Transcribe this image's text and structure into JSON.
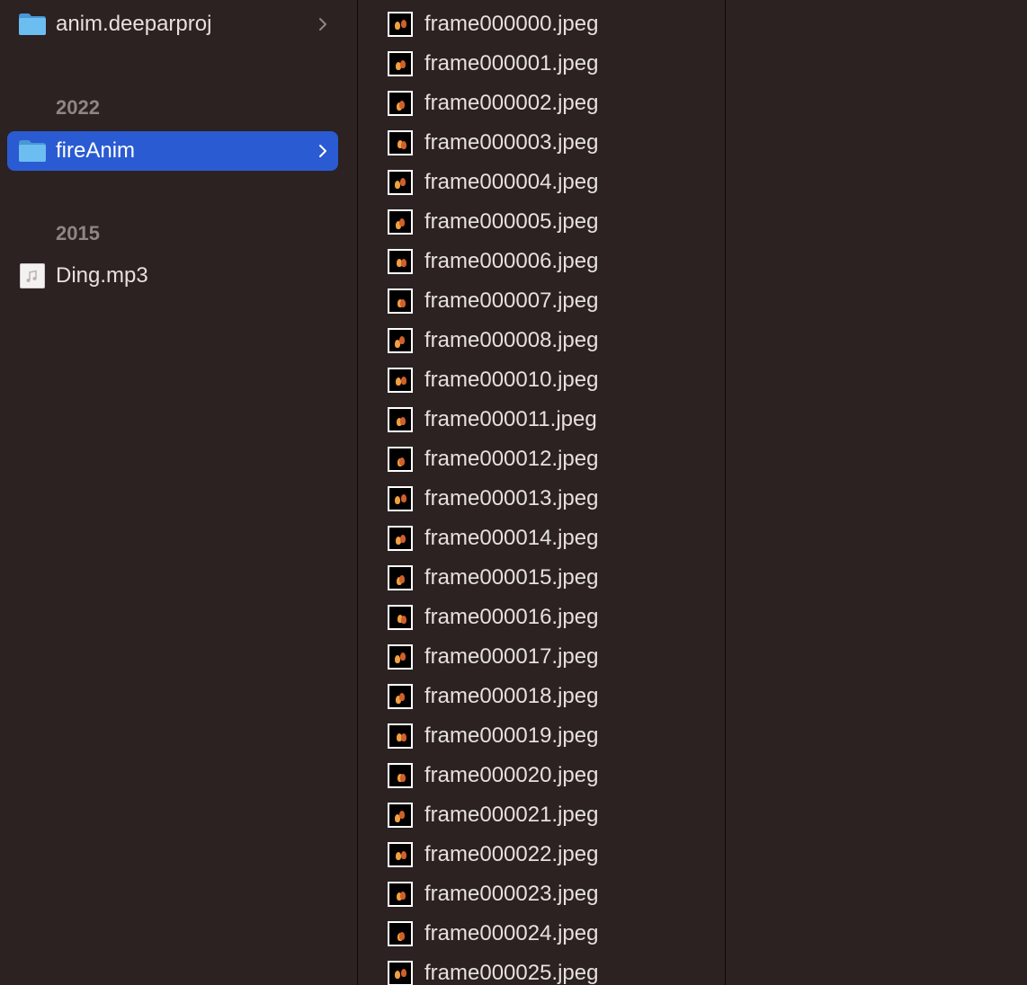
{
  "finder": {
    "column1": {
      "top_item": {
        "label": "anim.deeparproj",
        "icon": "folder-icon"
      },
      "sections": [
        {
          "header": "2022",
          "item": {
            "label": "fireAnim",
            "icon": "folder-icon",
            "selected": true
          }
        },
        {
          "header": "2015",
          "item": {
            "label": "Ding.mp3",
            "icon": "music-file-icon",
            "selected": false
          }
        }
      ]
    },
    "column2": {
      "files": [
        "frame000000.jpeg",
        "frame000001.jpeg",
        "frame000002.jpeg",
        "frame000003.jpeg",
        "frame000004.jpeg",
        "frame000005.jpeg",
        "frame000006.jpeg",
        "frame000007.jpeg",
        "frame000008.jpeg",
        "frame000010.jpeg",
        "frame000011.jpeg",
        "frame000012.jpeg",
        "frame000013.jpeg",
        "frame000014.jpeg",
        "frame000015.jpeg",
        "frame000016.jpeg",
        "frame000017.jpeg",
        "frame000018.jpeg",
        "frame000019.jpeg",
        "frame000020.jpeg",
        "frame000021.jpeg",
        "frame000022.jpeg",
        "frame000023.jpeg",
        "frame000024.jpeg",
        "frame000025.jpeg"
      ]
    },
    "colors": {
      "background": "#2b2221",
      "selection": "#2a5bd2",
      "folder": "#5aaee8",
      "text": "#e6e0df",
      "section_header": "#8e8685"
    }
  }
}
